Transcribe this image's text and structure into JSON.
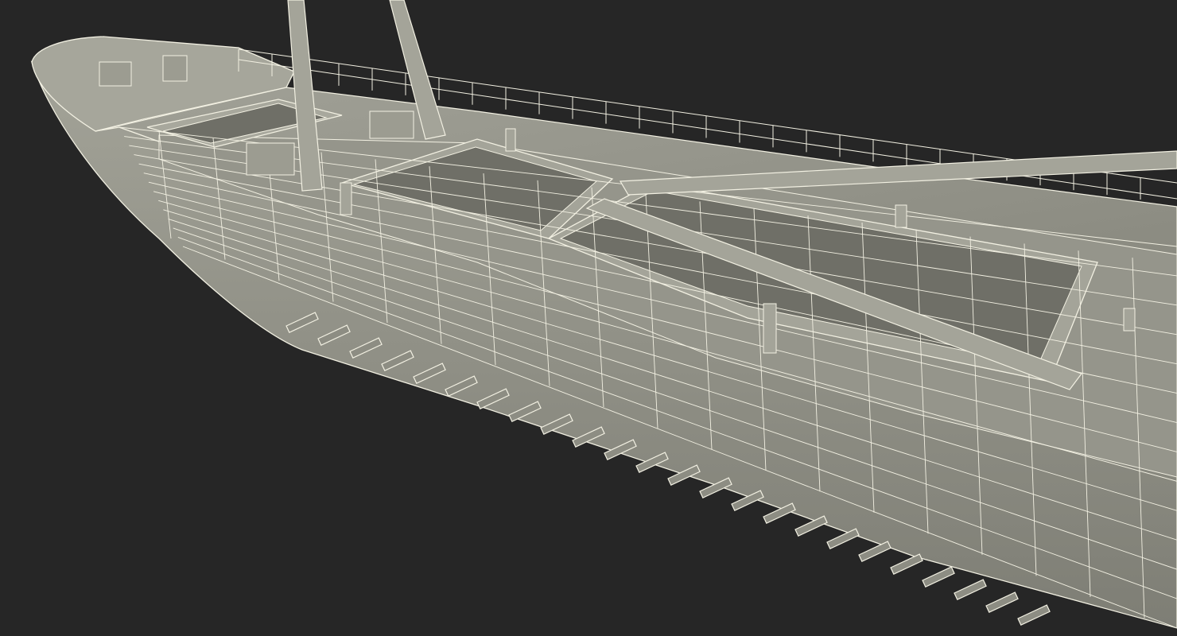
{
  "scene": {
    "subject": "ship-hull-wireframe-render",
    "colors": {
      "background": "#262626",
      "hull_fill": "#8d8d83",
      "hull_fill_light": "#a2a298",
      "deck_fill": "#96968c",
      "hold_inner": "#6f6f67",
      "wire": "#f2f0e2",
      "edge_dark": "#55554f"
    }
  }
}
